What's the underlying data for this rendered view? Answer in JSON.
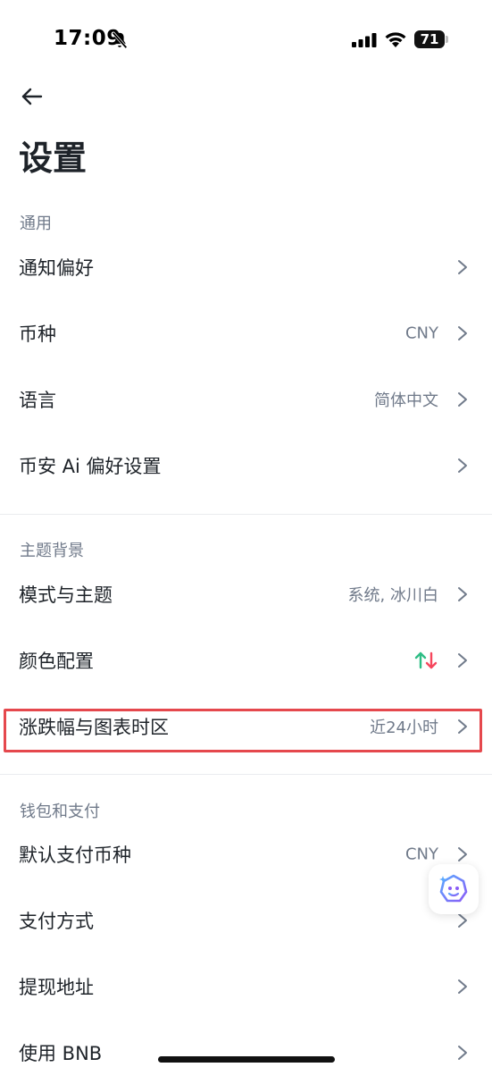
{
  "status_bar": {
    "time": "17:09",
    "battery": "71"
  },
  "header": {
    "title": "设置"
  },
  "sections": [
    {
      "header": "通用",
      "items": [
        {
          "label": "通知偏好",
          "value": ""
        },
        {
          "label": "币种",
          "value": "CNY"
        },
        {
          "label": "语言",
          "value": "简体中文"
        },
        {
          "label": "币安 Ai 偏好设置",
          "value": ""
        }
      ]
    },
    {
      "header": "主题背景",
      "items": [
        {
          "label": "模式与主题",
          "value": "系统, 冰川白"
        },
        {
          "label": "颜色配置",
          "value": ""
        },
        {
          "label": "涨跌幅与图表时区",
          "value": "近24小时"
        }
      ]
    },
    {
      "header": "钱包和支付",
      "items": [
        {
          "label": "默认支付币种",
          "value": "CNY"
        },
        {
          "label": "支付方式",
          "value": ""
        },
        {
          "label": "提现地址",
          "value": ""
        },
        {
          "label": "使用 BNB",
          "value": ""
        }
      ]
    }
  ],
  "colors": {
    "up": "#2ebd85",
    "down": "#f6465d",
    "highlight": "#e5484d",
    "text_primary": "#1e2329",
    "text_secondary": "#707a8a"
  },
  "icons": {
    "back": "arrow-left-icon",
    "chevron": "chevron-right-icon",
    "ai_assistant": "ai-assistant-icon",
    "color_config": "up-down-arrows-icon"
  }
}
